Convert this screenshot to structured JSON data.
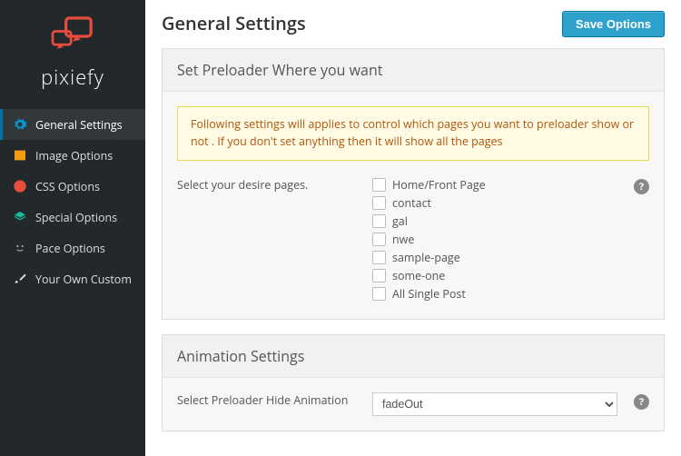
{
  "brand": {
    "name": "pixiefy"
  },
  "sidebar": {
    "items": [
      {
        "label": "General Settings"
      },
      {
        "label": "Image Options"
      },
      {
        "label": "CSS Options"
      },
      {
        "label": "Special Options"
      },
      {
        "label": "Pace Options"
      },
      {
        "label": "Your Own Custom"
      }
    ]
  },
  "header": {
    "title": "General Settings",
    "save": "Save Options"
  },
  "panel1": {
    "title": "Set Preloader Where you want",
    "notice": "Following settings will applies to control which pages you want to preloader show or not . If you don't set anything then it will show all the pages",
    "field_label": "Select your desire pages.",
    "options": [
      "Home/Front Page",
      "contact",
      "gal",
      "nwe",
      "sample-page",
      "some-one",
      "All Single Post"
    ]
  },
  "panel2": {
    "title": "Animation Settings",
    "field_label": "Select Preloader Hide Animation",
    "selected": "fadeOut"
  },
  "help_char": "?"
}
